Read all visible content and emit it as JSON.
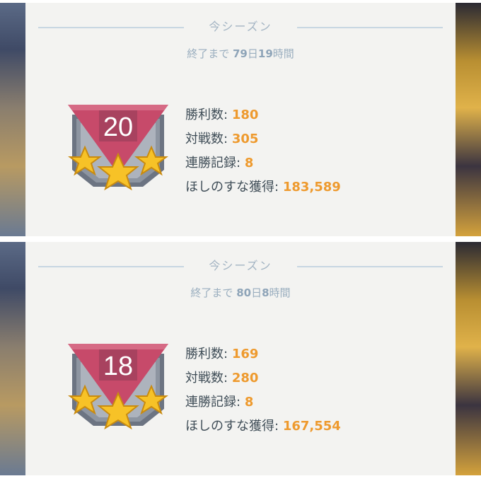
{
  "panels": [
    {
      "season_title": "今シーズン",
      "remaining": {
        "prefix": "終了まで",
        "days": "79",
        "days_unit": "日",
        "hours": "19",
        "hours_unit": "時間"
      },
      "medal": {
        "level": "20",
        "stars": 3
      },
      "stats": [
        {
          "label": "勝利数:",
          "value": "180"
        },
        {
          "label": "対戦数:",
          "value": "305"
        },
        {
          "label": "連勝記録:",
          "value": "8"
        },
        {
          "label": "ほしのすな獲得:",
          "value": "183,589"
        }
      ]
    },
    {
      "season_title": "今シーズン",
      "remaining": {
        "prefix": "終了まで",
        "days": "80",
        "days_unit": "日",
        "hours": "8",
        "hours_unit": "時間"
      },
      "medal": {
        "level": "18",
        "stars": 3
      },
      "stats": [
        {
          "label": "勝利数:",
          "value": "169"
        },
        {
          "label": "対戦数:",
          "value": "280"
        },
        {
          "label": "連勝記録:",
          "value": "8"
        },
        {
          "label": "ほしのすな獲得:",
          "value": "167,554"
        }
      ]
    }
  ],
  "colors": {
    "accent_value": "#ee9a2e",
    "label_text": "#3f4d57",
    "muted_text": "#a3b4c3",
    "medal_ribbon": "#c74a6a",
    "medal_frame": "#6c7482",
    "star_gold": "#f7c227"
  }
}
